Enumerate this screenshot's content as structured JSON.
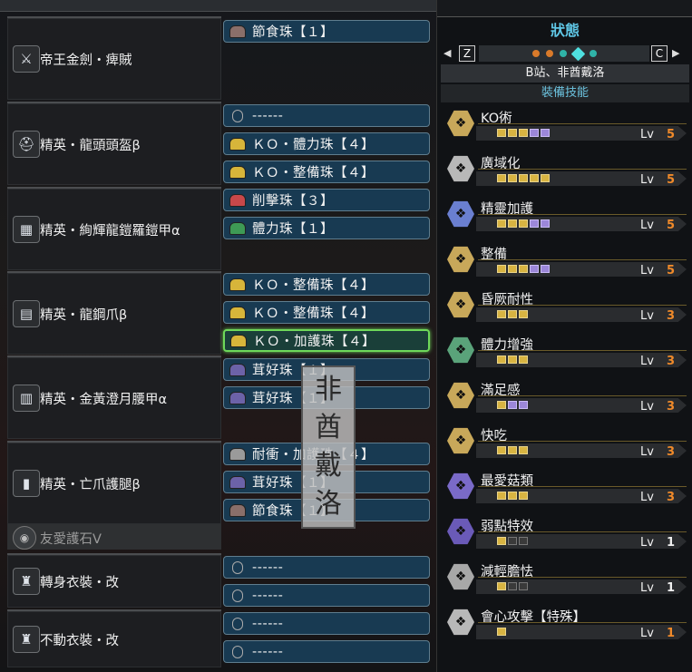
{
  "equipment": [
    {
      "name": "帝王金劍・痺賊",
      "icon": "weapon-icon",
      "slots": [
        {
          "name": "節食珠【１】",
          "color": "#8a6f6a",
          "empty": false
        }
      ]
    },
    {
      "name": "精英・龍頭頭盔β",
      "icon": "helmet-icon",
      "slots": [
        {
          "name": "------",
          "color": "",
          "empty": true
        },
        {
          "name": "ＫＯ・體力珠【４】",
          "color": "#d7b53a",
          "empty": false
        },
        {
          "name": "ＫＯ・整備珠【４】",
          "color": "#d7b53a",
          "empty": false
        }
      ]
    },
    {
      "name": "精英・絢輝龍鎧羅鎧甲α",
      "icon": "chest-icon",
      "slots": [
        {
          "name": "削擊珠【３】",
          "color": "#c8484a",
          "empty": false
        },
        {
          "name": "體力珠【１】",
          "color": "#3e9a55",
          "empty": false
        }
      ]
    },
    {
      "name": "精英・龍鋼爪β",
      "icon": "arm-icon",
      "slots": [
        {
          "name": "ＫＯ・整備珠【４】",
          "color": "#d7b53a",
          "empty": false
        },
        {
          "name": "ＫＯ・整備珠【４】",
          "color": "#d7b53a",
          "empty": false
        },
        {
          "name": "ＫＯ・加護珠【４】",
          "color": "#d7b53a",
          "empty": false,
          "highlight": true
        }
      ]
    },
    {
      "name": "精英・金黃澄月腰甲α",
      "icon": "waist-icon",
      "slots": [
        {
          "name": "茸好珠【１】",
          "color": "#6c62a8",
          "empty": false
        },
        {
          "name": "茸好珠【１】",
          "color": "#6c62a8",
          "empty": false
        }
      ]
    },
    {
      "name": "精英・亡爪護腿β",
      "icon": "leg-icon",
      "slots": [
        {
          "name": "耐衝・加護珠【４】",
          "color": "#9a9a9a",
          "empty": false
        },
        {
          "name": "茸好珠【１】",
          "color": "#6c62a8",
          "empty": false
        },
        {
          "name": "節食珠【１】",
          "color": "#8a6f6a",
          "empty": false
        }
      ]
    }
  ],
  "charm": {
    "name": "友愛護石Ⅴ",
    "icon": "charm-icon"
  },
  "mantles": [
    {
      "name": "轉身衣裝・改",
      "icon": "mantle-icon",
      "slots": [
        {
          "name": "------",
          "empty": true
        },
        {
          "name": "------",
          "empty": true
        }
      ]
    },
    {
      "name": "不動衣裝・改",
      "icon": "mantle-icon",
      "slots": [
        {
          "name": "------",
          "empty": true
        },
        {
          "name": "------",
          "empty": true
        }
      ]
    }
  ],
  "stamp": [
    "非",
    "酋",
    "戴",
    "洛"
  ],
  "panel": {
    "title": "狀態",
    "key_left": "Z",
    "key_right": "C",
    "set_name": "B站、非酋戴洛",
    "subtitle": "裝備技能",
    "dot_colors": [
      "#d97a2a",
      "#d97a2a",
      "#2fb3a8",
      "#4fe0e0",
      "#2fb3a8"
    ],
    "current_dot": 3
  },
  "skills": [
    {
      "name": "KO術",
      "level": "5",
      "pips": [
        "y",
        "y",
        "y",
        "p",
        "p"
      ],
      "color": "#c8a85a",
      "num_color": "#f08a2a"
    },
    {
      "name": "廣域化",
      "level": "5",
      "pips": [
        "y",
        "y",
        "y",
        "y",
        "y"
      ],
      "color": "#b8b8b8",
      "num_color": "#f08a2a"
    },
    {
      "name": "精靈加護",
      "level": "5",
      "pips": [
        "y",
        "y",
        "y",
        "p",
        "p"
      ],
      "color": "#6a7fd0",
      "num_color": "#f08a2a"
    },
    {
      "name": "整備",
      "level": "5",
      "pips": [
        "y",
        "y",
        "y",
        "p",
        "p"
      ],
      "color": "#c8a85a",
      "num_color": "#f08a2a"
    },
    {
      "name": "昏厥耐性",
      "level": "3",
      "pips": [
        "y",
        "y",
        "y"
      ],
      "color": "#c8a85a",
      "num_color": "#f08a2a"
    },
    {
      "name": "體力增強",
      "level": "3",
      "pips": [
        "y",
        "y",
        "y"
      ],
      "color": "#5aa37a",
      "num_color": "#f08a2a"
    },
    {
      "name": "滿足感",
      "level": "3",
      "pips": [
        "y",
        "p",
        "p"
      ],
      "color": "#c8a85a",
      "num_color": "#f08a2a"
    },
    {
      "name": "快吃",
      "level": "3",
      "pips": [
        "y",
        "y",
        "y"
      ],
      "color": "#c8a85a",
      "num_color": "#f08a2a"
    },
    {
      "name": "最愛菇類",
      "level": "3",
      "pips": [
        "y",
        "y",
        "y"
      ],
      "color": "#7a6ac8",
      "num_color": "#f08a2a"
    },
    {
      "name": "弱點特效",
      "level": "1",
      "pips": [
        "y",
        "e",
        "e"
      ],
      "color": "#6a5ab8",
      "num_color": "#f0f0f0"
    },
    {
      "name": "減輕膽怯",
      "level": "1",
      "pips": [
        "y",
        "e",
        "e"
      ],
      "color": "#a8a8a8",
      "num_color": "#f0f0f0"
    },
    {
      "name": "會心攻擊【特殊】",
      "level": "1",
      "pips": [
        "y"
      ],
      "color": "#b8b8b8",
      "num_color": "#f08a2a"
    }
  ],
  "lv_label": "Lv"
}
